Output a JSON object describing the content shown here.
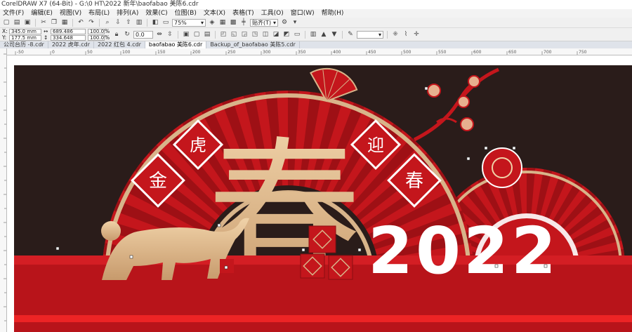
{
  "window": {
    "title": "CorelDRAW X7 (64-Bit) - G:\\0 HT\\2022 新年\\baofabao 美陈6.cdr"
  },
  "menu": [
    "文件(F)",
    "编辑(E)",
    "视图(V)",
    "布局(L)",
    "排列(A)",
    "效果(C)",
    "位图(B)",
    "文本(X)",
    "表格(T)",
    "工具(O)",
    "窗口(W)",
    "帮助(H)"
  ],
  "toolbar": {
    "zoom": "75%",
    "snap_label": "贴齐(T)"
  },
  "property_bar": {
    "x_label": "X:",
    "x_value": "345.0 mm",
    "y_label": "Y:",
    "y_value": "177.5 mm",
    "w_value": "689.486 mm",
    "h_value": "334.648 mm",
    "scale_x": "100.0",
    "scale_y": "100.0",
    "percent": "%",
    "rotation": "0.0"
  },
  "tabs": [
    "公司台历 -8.cdr",
    "2022 虎年.cdr",
    "2022 红包 4.cdr",
    "baofabao 美陈6.cdr",
    "Backup_of_baofabao 美陈5.cdr"
  ],
  "active_tab_index": 3,
  "ruler": {
    "h_ticks": [
      "-50",
      "0",
      "50",
      "100",
      "150",
      "200",
      "250",
      "300",
      "350",
      "400",
      "450",
      "500",
      "550",
      "600",
      "650",
      "700",
      "750"
    ]
  },
  "artwork": {
    "banner_chars": [
      "金",
      "虎",
      "迎",
      "春"
    ],
    "big_char": "春",
    "year": "2022"
  },
  "colors": {
    "background": "#2a1c1a",
    "red": "#c4161c",
    "dark_red": "#9e1015",
    "gold": "#d8b48a",
    "white": "#ffffff"
  }
}
